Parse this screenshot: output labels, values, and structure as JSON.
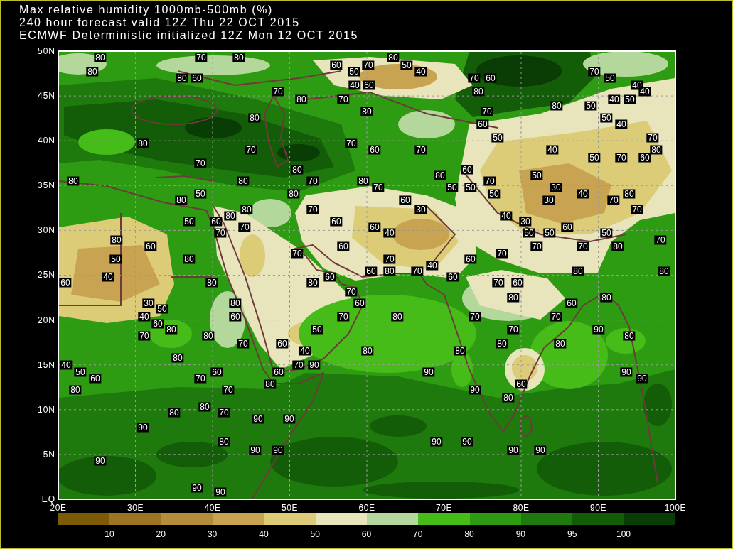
{
  "header": {
    "lines": [
      "Max relative humidity 1000mb-500mb (%)",
      "240 hour forecast valid 12Z Thu 22 OCT 2015",
      "ECMWF Deterministic initialized 12Z Mon 12 OCT 2015"
    ]
  },
  "map": {
    "latitude_labels": [
      "50N",
      "45N",
      "40N",
      "35N",
      "30N",
      "25N",
      "20N",
      "15N",
      "10N",
      "5N",
      "EQ"
    ],
    "longitude_labels": [
      "20E",
      "30E",
      "40E",
      "50E",
      "60E",
      "70E",
      "80E",
      "90E",
      "100E"
    ],
    "contour_labels": [
      "80",
      "70",
      "80",
      "80",
      "60",
      "70",
      "50",
      "80",
      "50",
      "40",
      "70",
      "80",
      "60",
      "70",
      "60",
      "50",
      "40",
      "60",
      "40",
      "70",
      "80",
      "40",
      "80",
      "70",
      "40",
      "50",
      "80",
      "50",
      "80",
      "70",
      "80",
      "50",
      "60",
      "40",
      "50",
      "70",
      "80",
      "70",
      "70",
      "60",
      "70",
      "40",
      "80",
      "50",
      "70",
      "60",
      "70",
      "80",
      "60",
      "80",
      "50",
      "80",
      "80",
      "70",
      "80",
      "70",
      "70",
      "50",
      "50",
      "30",
      "50",
      "80",
      "50",
      "40",
      "80",
      "80",
      "60",
      "30",
      "70",
      "80",
      "70",
      "30",
      "70",
      "80",
      "40",
      "50",
      "60",
      "60",
      "30",
      "70",
      "60",
      "60",
      "70",
      "40",
      "50",
      "50",
      "50",
      "80",
      "70",
      "60",
      "60",
      "70",
      "70",
      "80",
      "70",
      "70",
      "50",
      "80",
      "70",
      "60",
      "40",
      "60",
      "80",
      "70",
      "80",
      "80",
      "40",
      "60",
      "60",
      "60",
      "80",
      "80",
      "70",
      "60",
      "70",
      "80",
      "80",
      "30",
      "80",
      "60",
      "60",
      "50",
      "40",
      "60",
      "70",
      "80",
      "70",
      "70",
      "60",
      "80",
      "50",
      "70",
      "90",
      "70",
      "80",
      "80",
      "70",
      "60",
      "80",
      "80",
      "40",
      "80",
      "80",
      "80",
      "40",
      "70",
      "90",
      "50",
      "60",
      "60",
      "90",
      "90",
      "60",
      "70",
      "90",
      "80",
      "60",
      "80",
      "70",
      "90",
      "80",
      "80",
      "80",
      "70",
      "90",
      "90",
      "90",
      "80",
      "90",
      "90",
      "90",
      "90",
      "90",
      "90",
      "90",
      "90",
      "90"
    ]
  },
  "legend": {
    "segments": [
      {
        "color": "#7d5a0a"
      },
      {
        "color": "#9c7424"
      },
      {
        "color": "#b48c3c"
      },
      {
        "color": "#c8a452"
      },
      {
        "color": "#dccc78"
      },
      {
        "color": "#e8e4bc"
      },
      {
        "color": "#b4d89c"
      },
      {
        "color": "#46bc18"
      },
      {
        "color": "#2e9c12"
      },
      {
        "color": "#1e7a0c"
      },
      {
        "color": "#135c08"
      },
      {
        "color": "#0a3c05"
      }
    ],
    "labels": [
      "10",
      "20",
      "30",
      "40",
      "50",
      "60",
      "70",
      "80",
      "90",
      "95",
      "100"
    ]
  }
}
